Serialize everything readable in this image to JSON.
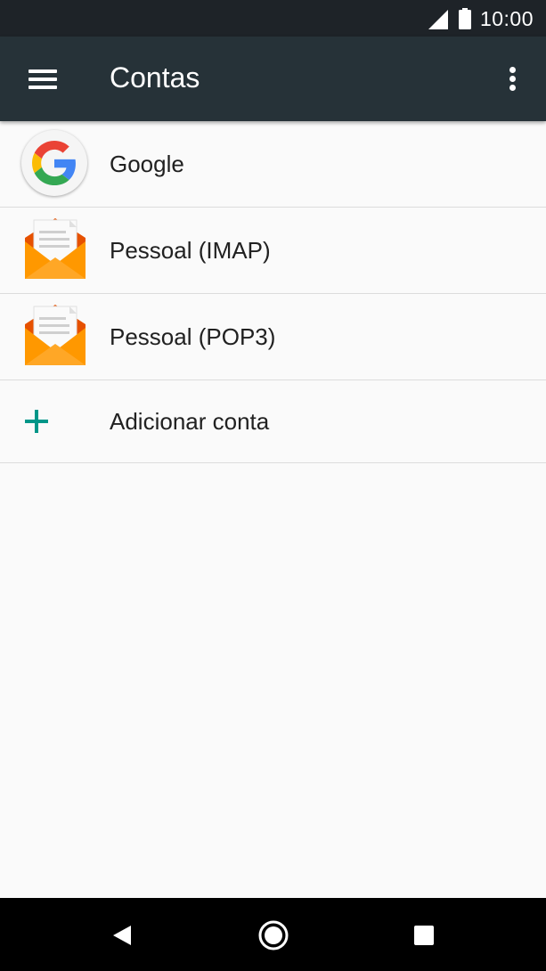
{
  "status_bar": {
    "time": "10:00",
    "icons": [
      "signal-icon",
      "battery-icon"
    ]
  },
  "app_bar": {
    "title": "Contas",
    "icons": [
      "menu-icon",
      "more-vert-icon"
    ]
  },
  "accounts": [
    {
      "label": "Google",
      "icon": "google-icon"
    },
    {
      "label": "Pessoal (IMAP)",
      "icon": "email-icon"
    },
    {
      "label": "Pessoal (POP3)",
      "icon": "email-icon"
    }
  ],
  "add_account": {
    "label": "Adicionar conta",
    "icon": "plus-icon"
  },
  "nav_bar": {
    "icons": [
      "back-icon",
      "home-icon",
      "recents-icon"
    ]
  },
  "colors": {
    "status_bar": "#1e2328",
    "app_bar": "#263238",
    "accent": "#009688",
    "email_orange": "#f57c00",
    "background": "#fafafa"
  }
}
